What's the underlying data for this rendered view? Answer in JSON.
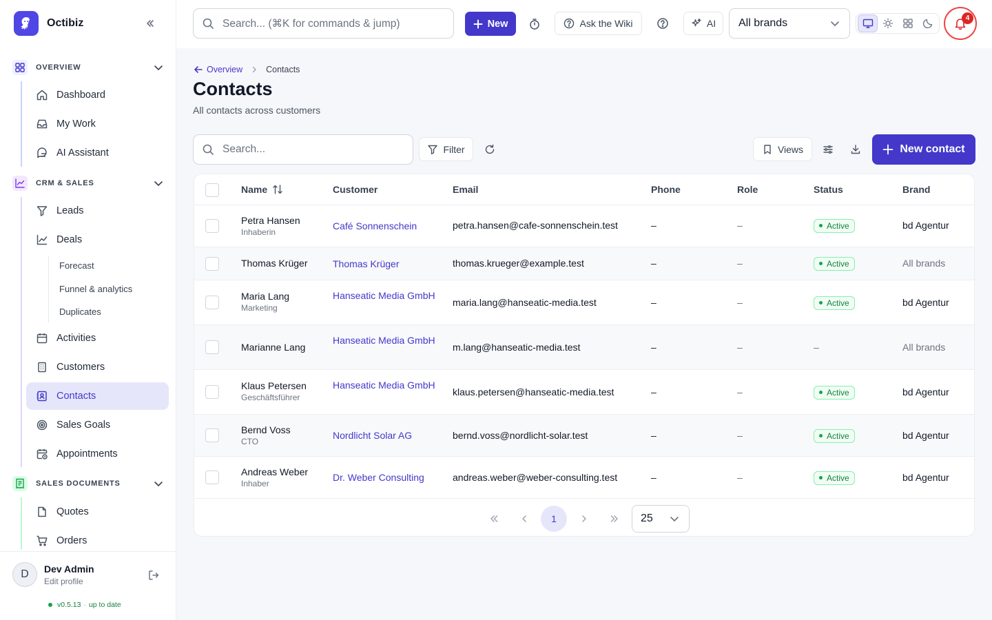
{
  "app": {
    "name": "Octibiz"
  },
  "topbar": {
    "search_placeholder": "Search... (⌘K for commands & jump)",
    "new_label": "New",
    "wiki_label": "Ask the Wiki",
    "ai_label": "AI",
    "brand_select": "All brands",
    "notification_count": "4"
  },
  "sidebar": {
    "sections": [
      {
        "label": "OVERVIEW",
        "items": [
          "Dashboard",
          "My Work",
          "AI Assistant"
        ]
      },
      {
        "label": "CRM & SALES",
        "items": [
          "Leads",
          "Deals",
          "Activities",
          "Customers",
          "Contacts",
          "Sales Goals",
          "Appointments"
        ]
      },
      {
        "label": "SALES DOCUMENTS",
        "items": [
          "Quotes",
          "Orders"
        ]
      }
    ],
    "deal_subitems": [
      "Forecast",
      "Funnel & analytics",
      "Duplicates"
    ],
    "active_item": "Contacts",
    "user": {
      "initial": "D",
      "name": "Dev Admin",
      "edit": "Edit profile"
    },
    "version": "v0.5.13",
    "version_status": "up to date"
  },
  "breadcrumb": {
    "back": "Overview",
    "current": "Contacts"
  },
  "page": {
    "title": "Contacts",
    "subtitle": "All contacts across customers"
  },
  "toolbar": {
    "search_placeholder": "Search...",
    "filter_label": "Filter",
    "views_label": "Views",
    "new_contact_label": "New contact"
  },
  "table": {
    "columns": [
      "Name",
      "Customer",
      "Email",
      "Phone",
      "Role",
      "Status",
      "Brand"
    ],
    "rows": [
      {
        "name": "Petra Hansen",
        "role_sub": "Inhaberin",
        "customer": "Café Sonnenschein",
        "email": "petra.hansen@cafe-sonnenschein.test",
        "phone": "–",
        "role": "–",
        "status": "Active",
        "brand": "bd Agentur"
      },
      {
        "name": "Thomas Krüger",
        "role_sub": "",
        "customer": "Thomas Krüger",
        "email": "thomas.krueger@example.test",
        "phone": "–",
        "role": "–",
        "status": "Active",
        "brand": "All brands"
      },
      {
        "name": "Maria Lang",
        "role_sub": "Marketing",
        "customer": "Hanseatic Media GmbH",
        "email": "maria.lang@hanseatic-media.test",
        "phone": "–",
        "role": "–",
        "status": "Active",
        "brand": "bd Agentur"
      },
      {
        "name": "Marianne Lang",
        "role_sub": "",
        "customer": "Hanseatic Media GmbH",
        "email": "m.lang@hanseatic-media.test",
        "phone": "–",
        "role": "–",
        "status": "–",
        "brand": "All brands"
      },
      {
        "name": "Klaus Petersen",
        "role_sub": "Geschäftsführer",
        "customer": "Hanseatic Media GmbH",
        "email": "klaus.petersen@hanseatic-media.test",
        "phone": "–",
        "role": "–",
        "status": "Active",
        "brand": "bd Agentur"
      },
      {
        "name": "Bernd Voss",
        "role_sub": "CTO",
        "customer": "Nordlicht Solar AG",
        "email": "bernd.voss@nordlicht-solar.test",
        "phone": "–",
        "role": "–",
        "status": "Active",
        "brand": "bd Agentur"
      },
      {
        "name": "Andreas Weber",
        "role_sub": "Inhaber",
        "customer": "Dr. Weber Consulting",
        "email": "andreas.weber@weber-consulting.test",
        "phone": "–",
        "role": "–",
        "status": "Active",
        "brand": "bd Agentur"
      }
    ]
  },
  "pagination": {
    "current_page": "1",
    "page_size": "25"
  },
  "colors": {
    "accent": "#4338ca",
    "active_bg": "#e6e6fb",
    "success": "#15803d",
    "alert": "#dc2626"
  }
}
